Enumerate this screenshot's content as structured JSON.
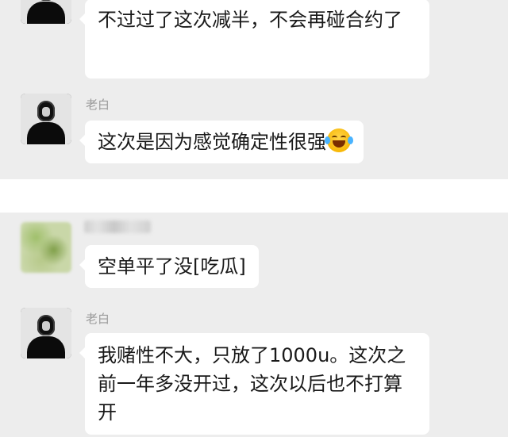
{
  "chat": {
    "sender_name": "老白",
    "messages": [
      {
        "text": "不过过了这次减半，不会再碰合约了"
      },
      {
        "text": "这次是因为感觉确定性很强"
      },
      {
        "text": "空单平了没[吃瓜]"
      },
      {
        "text": "我赌性不大，只放了1000u。这次之前一年多没开过，这次以后也不打算开"
      }
    ]
  },
  "icons": {
    "laugh_tears": "face-with-tears-of-joy-icon"
  },
  "colors": {
    "background_panel": "#ededed",
    "bubble": "#ffffff",
    "text": "#191919",
    "sender": "#9a9a9a"
  }
}
